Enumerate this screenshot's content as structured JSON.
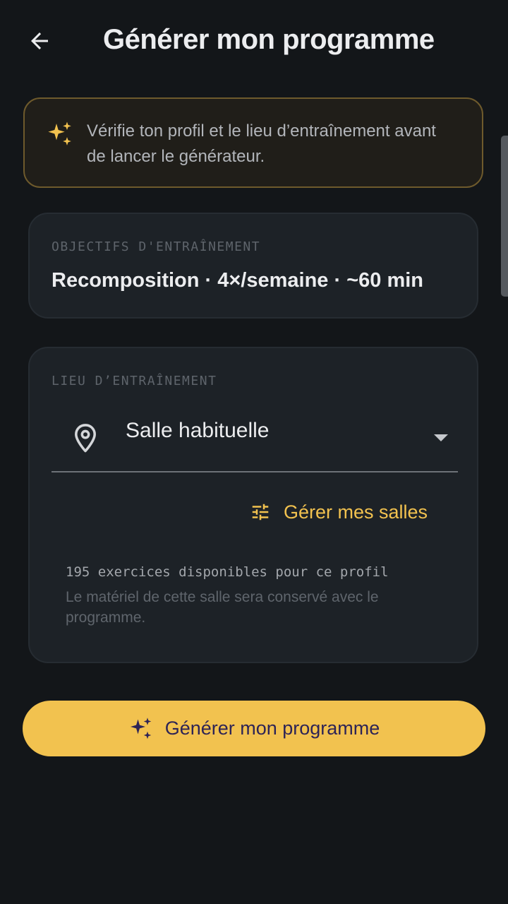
{
  "header": {
    "title": "Générer mon programme",
    "back_icon": "arrow-back-icon"
  },
  "banner": {
    "text": "Vérifie ton profil et le lieu d’entraînement avant de lancer le générateur.",
    "icon": "sparkles-icon",
    "accent": "#F2C24F"
  },
  "objectives": {
    "label": "OBJECTIFS D'ENTRAÎNEMENT",
    "value": "Recomposition · 4×/semaine · ~60 min"
  },
  "location": {
    "label": "LIEU D’ENTRAÎNEMENT",
    "selected": "Salle habituelle",
    "icon": "location-pin-icon",
    "manage_label": "Gérer mes salles",
    "manage_icon": "tune-sliders-icon",
    "count_text": "195 exercices disponibles pour ce profil",
    "note_text": "Le matériel de cette salle sera conservé avec le programme."
  },
  "cta": {
    "label": "Générer mon programme",
    "icon": "sparkles-icon",
    "background": "#F2C24F",
    "text_color": "#2E2456"
  },
  "colors": {
    "background": "#131619",
    "card": "#1D2227",
    "accent": "#F2C24F"
  }
}
